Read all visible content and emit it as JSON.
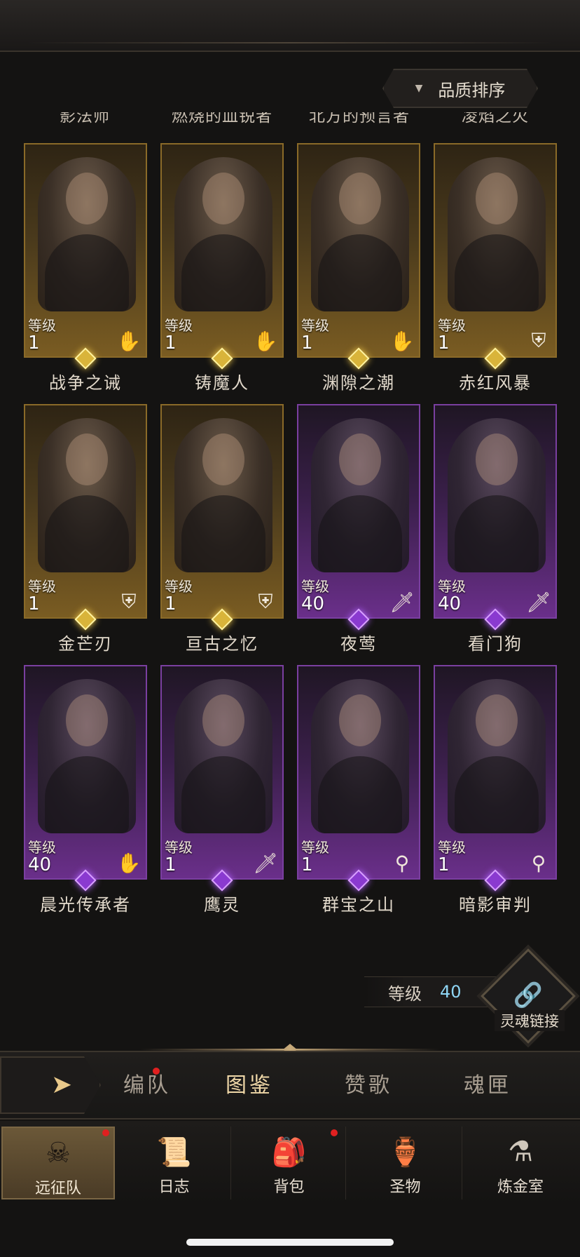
{
  "sort_button": {
    "label": "品质排序",
    "arrow": "▼"
  },
  "cutoff_names": [
    "影法师",
    "燃烧的血锐者",
    "北方的预言者",
    "凌焰之火"
  ],
  "level_label": "等级",
  "heroes": [
    {
      "name": "战争之诫",
      "level": "1",
      "rarity": "gold",
      "role": "hand-icon",
      "role_glyph": "✋"
    },
    {
      "name": "铸魔人",
      "level": "1",
      "rarity": "gold",
      "role": "hand-icon",
      "role_glyph": "✋"
    },
    {
      "name": "渊隙之潮",
      "level": "1",
      "rarity": "gold",
      "role": "hand-icon",
      "role_glyph": "✋"
    },
    {
      "name": "赤红风暴",
      "level": "1",
      "rarity": "gold",
      "role": "shield-icon",
      "role_glyph": "⛨"
    },
    {
      "name": "金芒刃",
      "level": "1",
      "rarity": "gold",
      "role": "shield-icon",
      "role_glyph": "⛨"
    },
    {
      "name": "亘古之忆",
      "level": "1",
      "rarity": "gold",
      "role": "shield-icon",
      "role_glyph": "⛨"
    },
    {
      "name": "夜莺",
      "level": "40",
      "rarity": "purple",
      "role": "sword-icon",
      "role_glyph": "🗡"
    },
    {
      "name": "看门狗",
      "level": "40",
      "rarity": "purple",
      "role": "sword-icon",
      "role_glyph": "🗡"
    },
    {
      "name": "晨光传承者",
      "level": "40",
      "rarity": "purple",
      "role": "hand-icon",
      "role_glyph": "✋"
    },
    {
      "name": "鹰灵",
      "level": "1",
      "rarity": "purple",
      "role": "sword-icon",
      "role_glyph": "🗡"
    },
    {
      "name": "群宝之山",
      "level": "1",
      "rarity": "purple",
      "role": "staff-icon",
      "role_glyph": "⚲"
    },
    {
      "name": "暗影审判",
      "level": "1",
      "rarity": "purple",
      "role": "staff-icon",
      "role_glyph": "⚲"
    }
  ],
  "soul_link": {
    "level_label": "等级",
    "level_value": "40",
    "label": "灵魂链接",
    "glyph": "🔗"
  },
  "tabs": [
    {
      "label": "编队",
      "active": false,
      "badge": true
    },
    {
      "label": "图鉴",
      "active": true,
      "badge": false
    },
    {
      "label": "赞歌",
      "active": false,
      "badge": false
    },
    {
      "label": "魂匣",
      "active": false,
      "badge": false
    }
  ],
  "nav": [
    {
      "label": "远征队",
      "icon": "helmet-icon",
      "glyph": "☠",
      "active": true,
      "badge": true
    },
    {
      "label": "日志",
      "icon": "scroll-icon",
      "glyph": "📜",
      "active": false,
      "badge": false
    },
    {
      "label": "背包",
      "icon": "bag-icon",
      "glyph": "🎒",
      "active": false,
      "badge": true
    },
    {
      "label": "圣物",
      "icon": "relic-icon",
      "glyph": "🏺",
      "active": false,
      "badge": false
    },
    {
      "label": "炼金室",
      "icon": "alchemy-icon",
      "glyph": "⚗",
      "active": false,
      "badge": false
    }
  ],
  "colors": {
    "gold_accent": "#d9b43a",
    "purple_accent": "#8a3ad0",
    "link_blue": "#4fc5f0"
  }
}
